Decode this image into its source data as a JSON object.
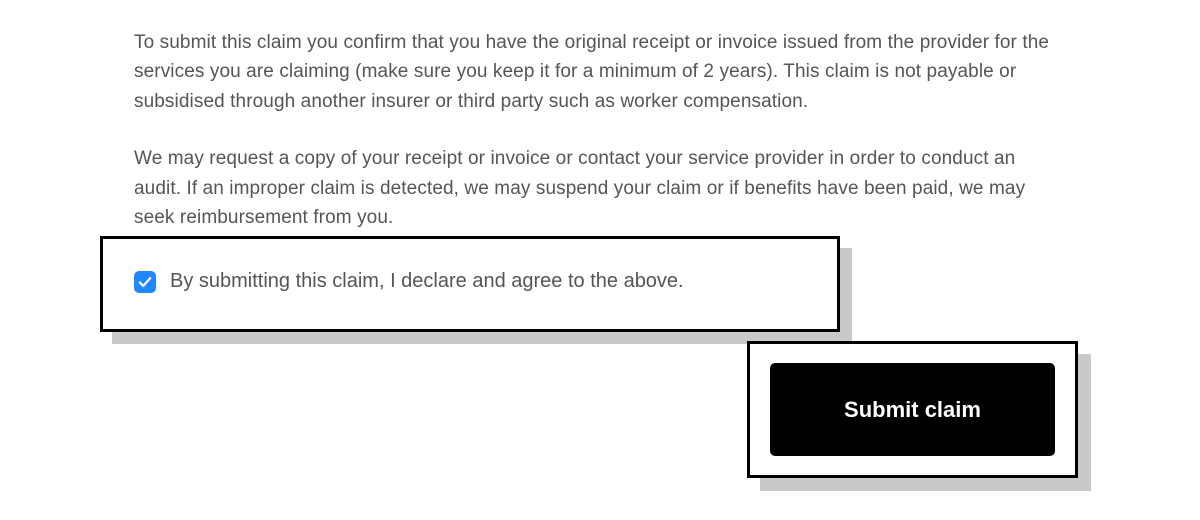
{
  "disclaimer": {
    "paragraph1": "To submit this claim you confirm that you have the original receipt or invoice issued from the provider for the services you are claiming (make sure you keep it for a minimum of 2 years). This claim is not payable or subsidised through another insurer or third party such as worker compensation.",
    "paragraph2": "We may request a copy of your receipt or invoice or contact your service provider in order to conduct an audit. If an improper claim is detected, we may suspend your claim or if benefits have been paid, we may seek reimbursement from you."
  },
  "agreement": {
    "label": "By submitting this claim, I declare and agree to the above.",
    "checked": true
  },
  "actions": {
    "submit_label": "Submit claim"
  }
}
